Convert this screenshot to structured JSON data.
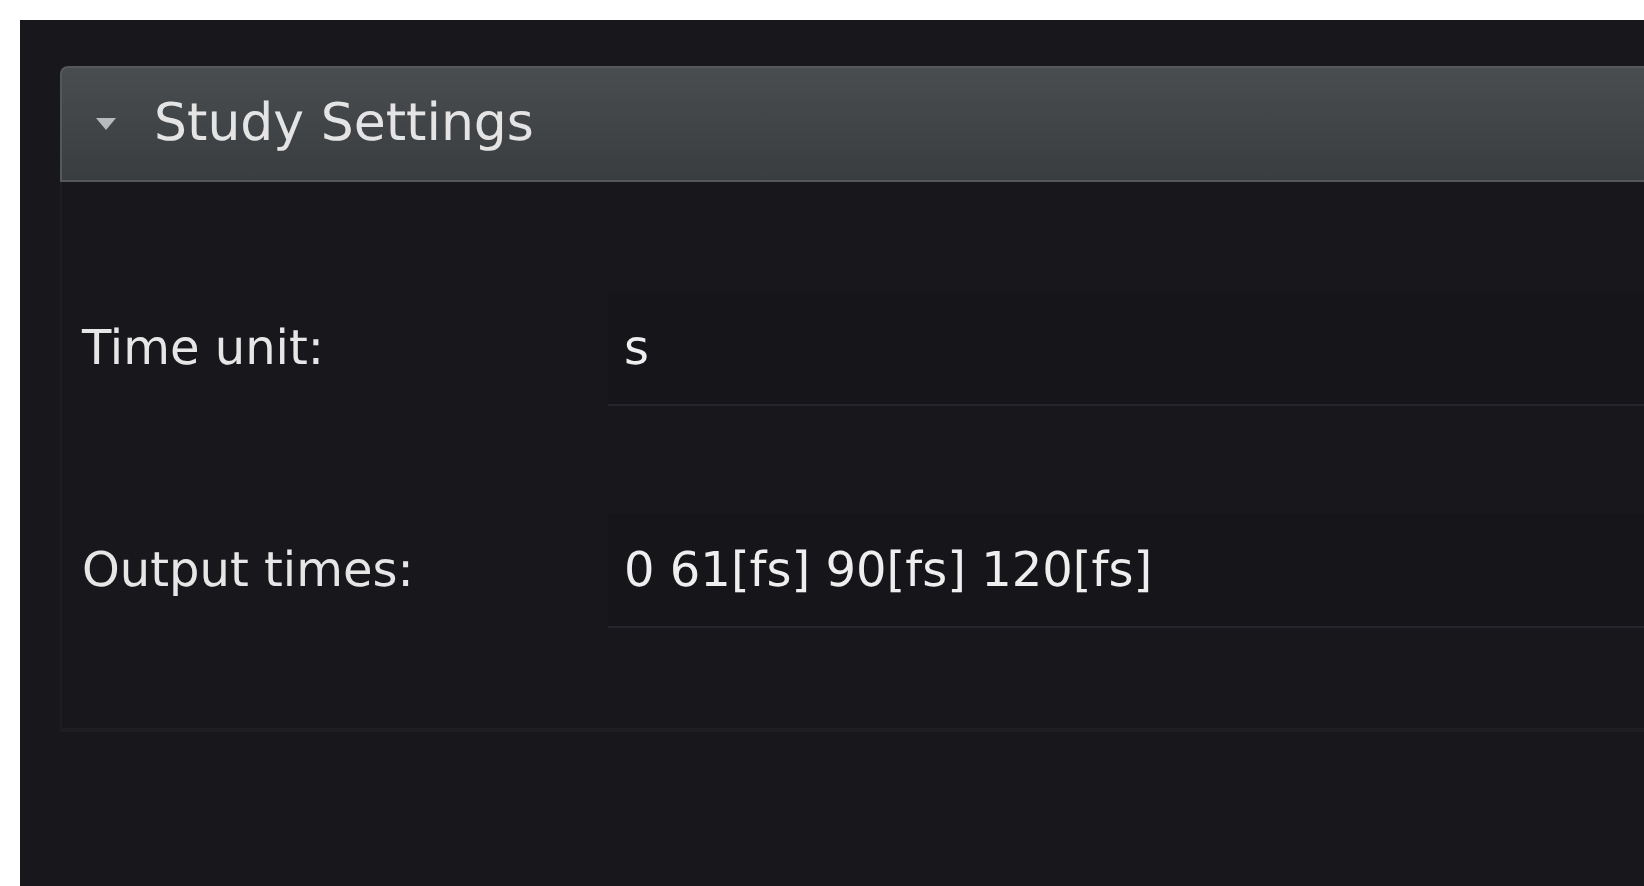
{
  "section": {
    "title": "Study Settings",
    "expanded": true
  },
  "fields": [
    {
      "label": "Time unit:",
      "value": "s"
    },
    {
      "label": "Output times:",
      "value": "0 61[fs] 90[fs] 120[fs]"
    }
  ]
}
